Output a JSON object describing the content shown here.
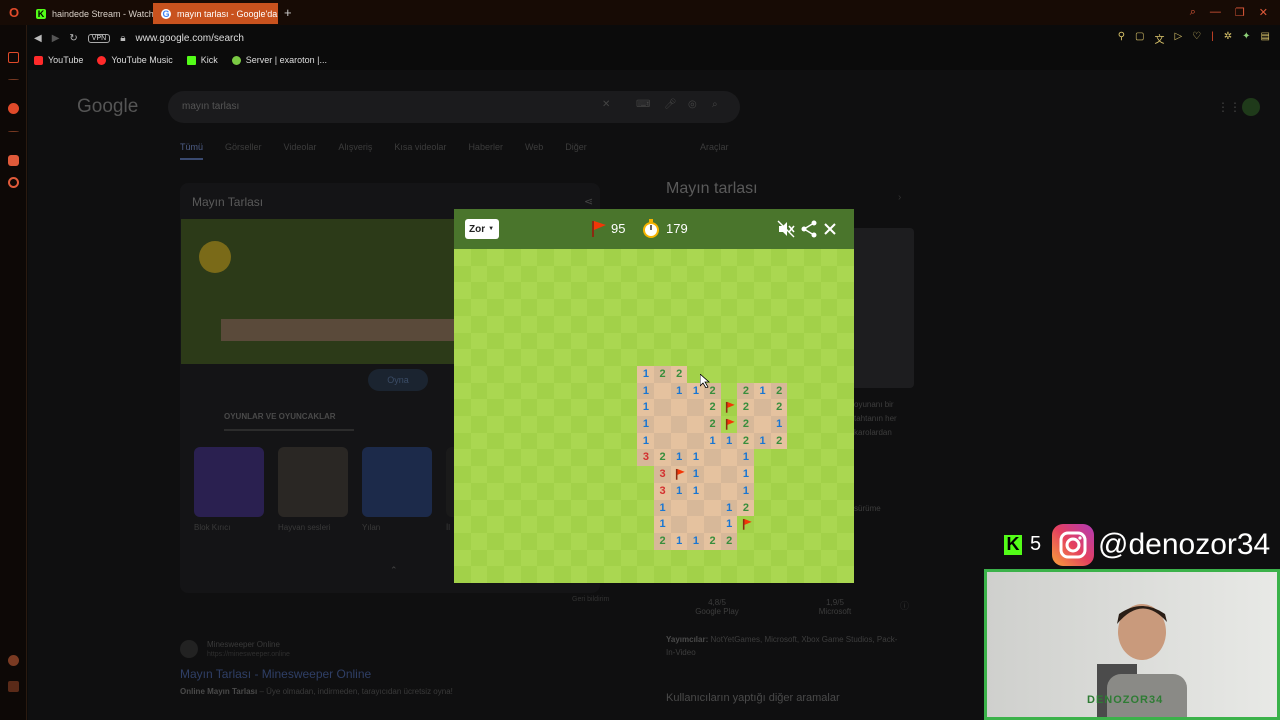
{
  "browser": {
    "tabs": [
      {
        "label": "haindede Stream - Watch",
        "active": false,
        "icon_color": "#53fc18"
      },
      {
        "label": "mayın tarlası - Google'da",
        "active": true,
        "icon_color": "#ffffff"
      }
    ],
    "address": "www.google.com/search",
    "vpn_label": "VPN",
    "bookmarks": [
      {
        "label": "YouTube",
        "icon_color": "#ff2a2a"
      },
      {
        "label": "YouTube Music",
        "icon_color": "#ff2a2a"
      },
      {
        "label": "Kick",
        "icon_color": "#53fc18"
      },
      {
        "label": "Server | exaroton |...",
        "icon_color": "#7ac943"
      }
    ],
    "accent": "#c8521e"
  },
  "google": {
    "logo": "Google",
    "query": "mayın tarlası",
    "tabs": [
      "Tümü",
      "Görseller",
      "Videolar",
      "Alışveriş",
      "Kısa videolar",
      "Haberler",
      "Web",
      "Diğer"
    ],
    "tools": "Araçlar",
    "card_title": "Mayın Tarlası",
    "play_label": "Oyna",
    "games_header": "OYUNLAR VE OYUNCAKLAR",
    "games": [
      "Blok Kırıcı",
      "Hayvan sesleri",
      "Yılan",
      "İl"
    ],
    "panel_title": "Mayın tarlası",
    "panel_text": "oyunanı bir tahtanın her karolardan",
    "panel_more": "sürüme",
    "ratings": [
      {
        "score": "4,8/5",
        "source": "Google Play"
      },
      {
        "score": "1,9/5",
        "source": "Microsoft"
      }
    ],
    "publishers_label": "Yayımcılar:",
    "publishers": "NotYetGames, Microsoft, Xbox Game Studios, Pack-In-Video",
    "related_title": "Kullanıcıların yaptığı diğer aramalar",
    "feedback": "Geri bildirim",
    "result": {
      "site": "Minesweeper Online",
      "url": "https://minesweeper.online",
      "title": "Mayın Tarlası - Minesweeper Online",
      "desc_bold": "Online Mayın Tarlası",
      "desc": " – Üye olmadan, indirmeden, tarayıcıdan ücretsiz oyna!"
    }
  },
  "minesweeper": {
    "difficulty": "Zor",
    "flags": "95",
    "time": "179",
    "colors": {
      "header": "#4a752c",
      "grass_light": "#aad751",
      "grass_dark": "#a2d149",
      "dirt_light": "#e5c29f",
      "dirt_dark": "#d7b899",
      "flag": "#f23607"
    },
    "board": {
      "cols": 24,
      "rows": 20,
      "revealed": [
        "11,7",
        "12,7",
        "13,7",
        "11,8",
        "12,8",
        "13,8",
        "14,8",
        "15,8",
        "17,8",
        "18,8",
        "19,8",
        "11,9",
        "12,9",
        "13,9",
        "14,9",
        "15,9",
        "17,9",
        "18,9",
        "19,9",
        "11,10",
        "12,10",
        "13,10",
        "14,10",
        "15,10",
        "17,10",
        "18,10",
        "19,10",
        "11,11",
        "12,11",
        "13,11",
        "14,11",
        "15,11",
        "16,11",
        "17,11",
        "18,11",
        "19,11",
        "11,12",
        "12,12",
        "13,12",
        "14,12",
        "15,12",
        "16,12",
        "17,12",
        "12,13",
        "13,13",
        "14,13",
        "15,13",
        "16,13",
        "17,13",
        "12,14",
        "13,14",
        "14,14",
        "15,14",
        "16,14",
        "17,14",
        "12,15",
        "13,15",
        "14,15",
        "15,15",
        "16,15",
        "17,15",
        "12,16",
        "13,16",
        "14,16",
        "15,16",
        "16,16",
        "12,17",
        "13,17",
        "14,17",
        "15,17",
        "16,17"
      ],
      "numbers": [
        {
          "c": 11,
          "r": 7,
          "v": "1"
        },
        {
          "c": 12,
          "r": 7,
          "v": "2"
        },
        {
          "c": 13,
          "r": 7,
          "v": "2"
        },
        {
          "c": 11,
          "r": 8,
          "v": "1"
        },
        {
          "c": 13,
          "r": 8,
          "v": "1"
        },
        {
          "c": 14,
          "r": 8,
          "v": "1"
        },
        {
          "c": 15,
          "r": 8,
          "v": "2"
        },
        {
          "c": 17,
          "r": 8,
          "v": "2"
        },
        {
          "c": 18,
          "r": 8,
          "v": "1"
        },
        {
          "c": 19,
          "r": 8,
          "v": "2"
        },
        {
          "c": 11,
          "r": 9,
          "v": "1"
        },
        {
          "c": 15,
          "r": 9,
          "v": "2"
        },
        {
          "c": 17,
          "r": 9,
          "v": "2"
        },
        {
          "c": 19,
          "r": 9,
          "v": "2"
        },
        {
          "c": 11,
          "r": 10,
          "v": "1"
        },
        {
          "c": 15,
          "r": 10,
          "v": "2"
        },
        {
          "c": 17,
          "r": 10,
          "v": "2"
        },
        {
          "c": 19,
          "r": 10,
          "v": "1"
        },
        {
          "c": 11,
          "r": 11,
          "v": "1"
        },
        {
          "c": 15,
          "r": 11,
          "v": "1"
        },
        {
          "c": 16,
          "r": 11,
          "v": "1"
        },
        {
          "c": 17,
          "r": 11,
          "v": "2"
        },
        {
          "c": 18,
          "r": 11,
          "v": "1"
        },
        {
          "c": 19,
          "r": 11,
          "v": "2"
        },
        {
          "c": 11,
          "r": 12,
          "v": "3"
        },
        {
          "c": 12,
          "r": 12,
          "v": "2"
        },
        {
          "c": 13,
          "r": 12,
          "v": "1"
        },
        {
          "c": 14,
          "r": 12,
          "v": "1"
        },
        {
          "c": 17,
          "r": 12,
          "v": "1"
        },
        {
          "c": 12,
          "r": 13,
          "v": "3"
        },
        {
          "c": 14,
          "r": 13,
          "v": "1"
        },
        {
          "c": 17,
          "r": 13,
          "v": "1"
        },
        {
          "c": 12,
          "r": 14,
          "v": "3"
        },
        {
          "c": 13,
          "r": 14,
          "v": "1"
        },
        {
          "c": 14,
          "r": 14,
          "v": "1"
        },
        {
          "c": 17,
          "r": 14,
          "v": "1"
        },
        {
          "c": 12,
          "r": 15,
          "v": "1"
        },
        {
          "c": 16,
          "r": 15,
          "v": "1"
        },
        {
          "c": 17,
          "r": 15,
          "v": "2"
        },
        {
          "c": 12,
          "r": 16,
          "v": "1"
        },
        {
          "c": 16,
          "r": 16,
          "v": "1"
        },
        {
          "c": 12,
          "r": 17,
          "v": "2"
        },
        {
          "c": 13,
          "r": 17,
          "v": "1"
        },
        {
          "c": 14,
          "r": 17,
          "v": "1"
        },
        {
          "c": 15,
          "r": 17,
          "v": "2"
        },
        {
          "c": 16,
          "r": 17,
          "v": "2"
        }
      ],
      "flags": [
        {
          "c": 16,
          "r": 9
        },
        {
          "c": 16,
          "r": 10
        },
        {
          "c": 13,
          "r": 13
        },
        {
          "c": 17,
          "r": 16
        }
      ]
    }
  },
  "overlay": {
    "kick_count": "5",
    "instagram": "@denozor34",
    "cam_name": "DENOZOR34"
  }
}
